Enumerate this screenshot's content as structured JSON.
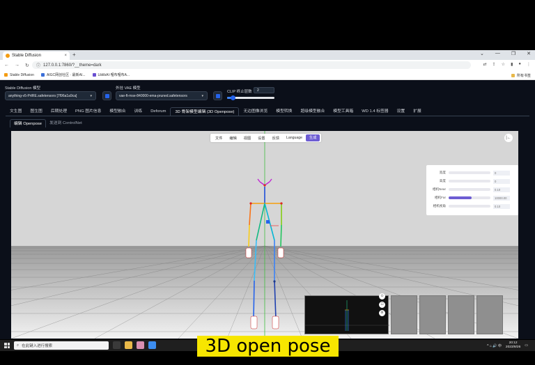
{
  "browser": {
    "tab_title": "Stable Diffusion",
    "tab_close": "×",
    "new_tab": "+",
    "window_controls": [
      "⌄",
      "—",
      "❐",
      "✕"
    ],
    "url": "127.0.0.1:7860/?__theme=dark",
    "bookmarks": [
      "Stable Diffusion",
      "AIGC网创社区 · 最新AI...",
      "LiblibAI·哩布哩布A..."
    ],
    "bookmarks_right": "所有书签"
  },
  "app": {
    "sd_model_label": "Stable Diffusion 模型",
    "sd_model_value": "anything-v5-PrtRE.safetensors [7f96a1a9ca]",
    "vae_label": "外挂 VAE 模型",
    "vae_value": "vae-ft-mse-840000-ema-pruned.safetensors",
    "clip_label": "CLIP 终止层数",
    "clip_value": "2",
    "tabs": [
      "文生图",
      "图生图",
      "后期处理",
      "PNG 图片信息",
      "模型融合",
      "训练",
      "Deforum",
      "3D 骨架模型编辑 (3D Openpose)",
      "无边图像浏览",
      "模型转换",
      "超级模型融合",
      "模型工具箱",
      "WD 1.4 标签器",
      "设置",
      "扩展"
    ],
    "active_tab": 7,
    "subtabs": [
      "编辑 Openpose",
      "发送到 ControlNet"
    ]
  },
  "editor": {
    "menu": [
      "文件",
      "编辑",
      "视图",
      "设置",
      "反馈",
      "Language",
      "生成"
    ],
    "expand_icon": "|←",
    "params": [
      {
        "label": "宽度",
        "value": "0",
        "fill": 0
      },
      {
        "label": "高度",
        "value": "0",
        "fill": 0
      },
      {
        "label": "相机Near",
        "value": "0.10",
        "fill": 0
      },
      {
        "label": "相机Far",
        "value": "10000.00",
        "fill": 0.55
      },
      {
        "label": "相机视角",
        "value": "0.10",
        "fill": 0
      }
    ]
  },
  "taskbar": {
    "search_placeholder": "在此键入进行搜索",
    "time": "20:12",
    "date": "2023/9/26",
    "tray_icons": "^ ⌂ 🔊 中"
  },
  "caption": "3D open pose"
}
